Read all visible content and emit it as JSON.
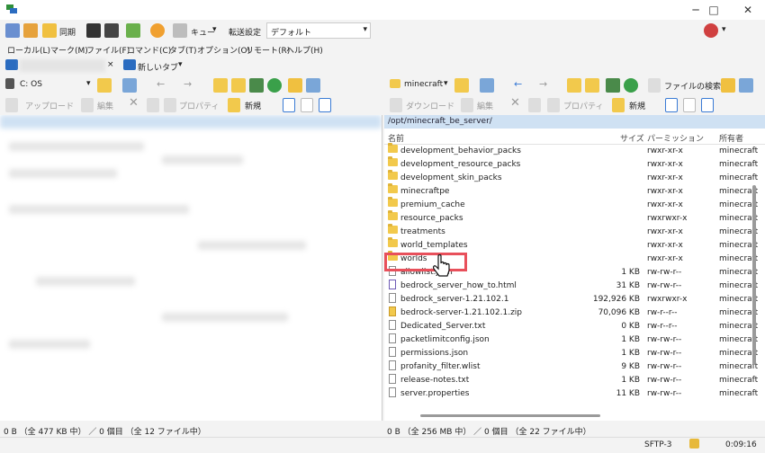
{
  "window": {
    "minimize": "─",
    "maximize": "□",
    "close": "✕"
  },
  "toolbar": {
    "sync_label": "同期",
    "queue_label": "キュー",
    "transfer_setting_label": "転送設定",
    "transfer_setting_value": "デフォルト"
  },
  "menu": [
    "ローカル(L)",
    "マーク(M)",
    "ファイル(F)",
    "コマンド(C)",
    "タブ(T)",
    "オプション(O)",
    "リモート(R)",
    "ヘルプ(H)"
  ],
  "tabs": {
    "new_tab": "新しいタブ",
    "close": "×"
  },
  "left": {
    "drive": "C: OS",
    "upload": "アップロード",
    "edit": "編集",
    "properties": "プロパティ",
    "new": "新規",
    "status": "0 B （全 477 KB 中） ／ 0 個目 （全 12 ファイル中）"
  },
  "right": {
    "location": "minecraft",
    "find_files": "ファイルの検索",
    "download": "ダウンロード",
    "edit": "編集",
    "properties": "プロパティ",
    "new": "新規",
    "path": "/opt/minecraft_be_server/",
    "columns": {
      "name": "名前",
      "size": "サイズ",
      "perms": "パーミッション",
      "owner": "所有者"
    },
    "files": [
      {
        "name": "development_behavior_packs",
        "size": "",
        "perms": "rwxr-xr-x",
        "owner": "minecraft",
        "type": "folder"
      },
      {
        "name": "development_resource_packs",
        "size": "",
        "perms": "rwxr-xr-x",
        "owner": "minecraft",
        "type": "folder"
      },
      {
        "name": "development_skin_packs",
        "size": "",
        "perms": "rwxr-xr-x",
        "owner": "minecraft",
        "type": "folder"
      },
      {
        "name": "minecraftpe",
        "size": "",
        "perms": "rwxr-xr-x",
        "owner": "minecraft",
        "type": "folder"
      },
      {
        "name": "premium_cache",
        "size": "",
        "perms": "rwxr-xr-x",
        "owner": "minecraft",
        "type": "folder"
      },
      {
        "name": "resource_packs",
        "size": "",
        "perms": "rwxrwxr-x",
        "owner": "minecraft",
        "type": "folder"
      },
      {
        "name": "treatments",
        "size": "",
        "perms": "rwxr-xr-x",
        "owner": "minecraft",
        "type": "folder"
      },
      {
        "name": "world_templates",
        "size": "",
        "perms": "rwxr-xr-x",
        "owner": "minecraft",
        "type": "folder"
      },
      {
        "name": "worlds",
        "size": "",
        "perms": "rwxr-xr-x",
        "owner": "minecraft",
        "type": "folder"
      },
      {
        "name": "allowlist.json",
        "size": "1 KB",
        "perms": "rw-rw-r--",
        "owner": "minecraft",
        "type": "file"
      },
      {
        "name": "bedrock_server_how_to.html",
        "size": "31 KB",
        "perms": "rw-rw-r--",
        "owner": "minecraft",
        "type": "html"
      },
      {
        "name": "bedrock_server-1.21.102.1",
        "size": "192,926 KB",
        "perms": "rwxrwxr-x",
        "owner": "minecraft",
        "type": "file"
      },
      {
        "name": "bedrock-server-1.21.102.1.zip",
        "size": "70,096 KB",
        "perms": "rw-r--r--",
        "owner": "minecraft",
        "type": "zip"
      },
      {
        "name": "Dedicated_Server.txt",
        "size": "0 KB",
        "perms": "rw-r--r--",
        "owner": "minecraft",
        "type": "file"
      },
      {
        "name": "packetlimitconfig.json",
        "size": "1 KB",
        "perms": "rw-rw-r--",
        "owner": "minecraft",
        "type": "file"
      },
      {
        "name": "permissions.json",
        "size": "1 KB",
        "perms": "rw-rw-r--",
        "owner": "minecraft",
        "type": "file"
      },
      {
        "name": "profanity_filter.wlist",
        "size": "9 KB",
        "perms": "rw-rw-r--",
        "owner": "minecraft",
        "type": "file"
      },
      {
        "name": "release-notes.txt",
        "size": "1 KB",
        "perms": "rw-rw-r--",
        "owner": "minecraft",
        "type": "file"
      },
      {
        "name": "server.properties",
        "size": "11 KB",
        "perms": "rw-rw-r--",
        "owner": "minecraft",
        "type": "file"
      }
    ],
    "status": "0 B （全 256 MB 中） ／ 0 個目 （全 22 ファイル中）"
  },
  "statusbar": {
    "protocol": "SFTP-3",
    "elapsed": "0:09:16"
  },
  "colors": {
    "path_bg": "#cfe1f3",
    "highlight": "#e8505b"
  }
}
